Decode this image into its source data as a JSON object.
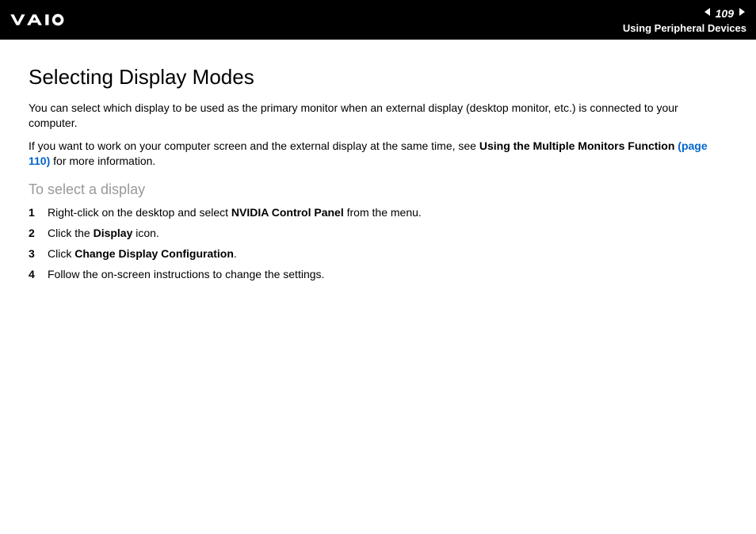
{
  "header": {
    "page_number": "109",
    "section_name": "Using Peripheral Devices"
  },
  "title": "Selecting Display Modes",
  "intro_para": "You can select which display to be used as the primary monitor when an external display (desktop monitor, etc.) is connected to your computer.",
  "see_also": {
    "prefix": "If you want to work on your computer screen and the external display at the same time, see ",
    "bold_text": "Using the Multiple Monitors Function",
    "link_text": "(page 110)",
    "suffix": " for more information."
  },
  "subheading": "To select a display",
  "steps": [
    {
      "num": "1",
      "parts": [
        {
          "text": "Right-click on the desktop and select ",
          "bold": false
        },
        {
          "text": "NVIDIA Control Panel",
          "bold": true
        },
        {
          "text": " from the menu.",
          "bold": false
        }
      ]
    },
    {
      "num": "2",
      "parts": [
        {
          "text": "Click the ",
          "bold": false
        },
        {
          "text": "Display",
          "bold": true
        },
        {
          "text": " icon.",
          "bold": false
        }
      ]
    },
    {
      "num": "3",
      "parts": [
        {
          "text": "Click ",
          "bold": false
        },
        {
          "text": "Change Display Configuration",
          "bold": true
        },
        {
          "text": ".",
          "bold": false
        }
      ]
    },
    {
      "num": "4",
      "parts": [
        {
          "text": "Follow the on-screen instructions to change the settings.",
          "bold": false
        }
      ]
    }
  ]
}
